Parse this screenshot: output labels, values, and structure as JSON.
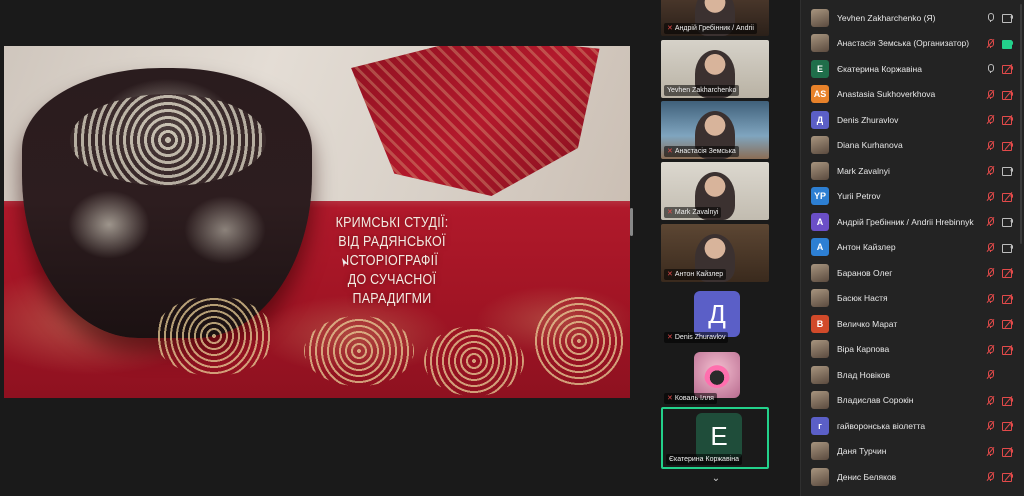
{
  "slide": {
    "title_lines": [
      "КРИМСЬКІ СТУДІЇ:",
      "ВІД РАДЯНСЬКОЇ ІСТОРІОГРАФІЇ",
      "ДО СУЧАСНОЇ ПАРАДИГМИ"
    ]
  },
  "video_tiles": [
    {
      "name": "Андрій Гребінник / Andrii",
      "muted": true,
      "kind": "camera"
    },
    {
      "name": "Yevhen Zakharchenko",
      "muted": false,
      "kind": "camera"
    },
    {
      "name": "Анастасія Земська",
      "muted": true,
      "kind": "camera"
    },
    {
      "name": "Mark Zavalnyi",
      "muted": true,
      "kind": "camera"
    },
    {
      "name": "Антон Кайзлер",
      "muted": true,
      "kind": "camera"
    },
    {
      "name": "Denis Zhuravlov",
      "muted": true,
      "kind": "avatar",
      "initial": "Д",
      "color": "#5b5fc7"
    },
    {
      "name": "Коваль Ілля",
      "muted": true,
      "kind": "avatar",
      "initial": "",
      "color": "#c06b8f"
    },
    {
      "name": "Єкатерина Коржавіна",
      "muted": false,
      "kind": "avatar",
      "initial": "Е",
      "color": "#1f4d3a",
      "active_speaker": true
    }
  ],
  "participants": [
    {
      "name": "Yevhen Zakharchenko (Я)",
      "avatar": "photo",
      "initials": "",
      "color": "",
      "mic": "on",
      "cam": "on"
    },
    {
      "name": "Анастасія Земська (Организатор)",
      "avatar": "photo",
      "initials": "",
      "color": "",
      "mic": "off",
      "cam": "live"
    },
    {
      "name": "Єкатерина Коржавіна",
      "avatar": "initials",
      "initials": "Е",
      "color": "#1f6e4a",
      "mic": "on",
      "cam": "off"
    },
    {
      "name": "Anastasia Sukhoverkhova",
      "avatar": "initials",
      "initials": "AS",
      "color": "#e8822a",
      "mic": "off",
      "cam": "off"
    },
    {
      "name": "Denis Zhuravlov",
      "avatar": "initials",
      "initials": "Д",
      "color": "#5b5fc7",
      "mic": "off",
      "cam": "off"
    },
    {
      "name": "Diana Kurhanova",
      "avatar": "photo",
      "initials": "",
      "color": "",
      "mic": "off",
      "cam": "off"
    },
    {
      "name": "Mark Zavalnyi",
      "avatar": "photo",
      "initials": "",
      "color": "",
      "mic": "off",
      "cam": "on"
    },
    {
      "name": "Yurii Petrov",
      "avatar": "initials",
      "initials": "YP",
      "color": "#2d7fd3",
      "mic": "off",
      "cam": "off"
    },
    {
      "name": "Андрій Гребінник / Andrii Hrebinnyk",
      "avatar": "initials",
      "initials": "А",
      "color": "#6b4fc7",
      "mic": "off",
      "cam": "on"
    },
    {
      "name": "Антон Кайзлер",
      "avatar": "initials",
      "initials": "А",
      "color": "#2d7fd3",
      "mic": "off",
      "cam": "on"
    },
    {
      "name": "Баранов Олег",
      "avatar": "photo",
      "initials": "",
      "color": "",
      "mic": "off",
      "cam": "off"
    },
    {
      "name": "Басюк Настя",
      "avatar": "photo",
      "initials": "",
      "color": "",
      "mic": "off",
      "cam": "off"
    },
    {
      "name": "Величко Марат",
      "avatar": "initials",
      "initials": "В",
      "color": "#d14a2a",
      "mic": "off",
      "cam": "off"
    },
    {
      "name": "Віра Карпова",
      "avatar": "photo",
      "initials": "",
      "color": "",
      "mic": "off",
      "cam": "off"
    },
    {
      "name": "Влад Новіков",
      "avatar": "photo",
      "initials": "",
      "color": "",
      "mic": "off",
      "cam": "none"
    },
    {
      "name": "Владислав Сорокін",
      "avatar": "photo",
      "initials": "",
      "color": "",
      "mic": "off",
      "cam": "off"
    },
    {
      "name": "гайворонська віолетта",
      "avatar": "initials",
      "initials": "г",
      "color": "#5b5fc7",
      "mic": "off",
      "cam": "off"
    },
    {
      "name": "Даня Турчин",
      "avatar": "photo",
      "initials": "",
      "color": "",
      "mic": "off",
      "cam": "off"
    },
    {
      "name": "Денис Беляков",
      "avatar": "photo",
      "initials": "",
      "color": "",
      "mic": "off",
      "cam": "off"
    }
  ],
  "icons": {
    "strip_scroll": "chevron-down-icon"
  },
  "colors": {
    "active_speaker": "#23d18b",
    "muted_red": "#e34a4a",
    "panel_bg": "#232323"
  }
}
